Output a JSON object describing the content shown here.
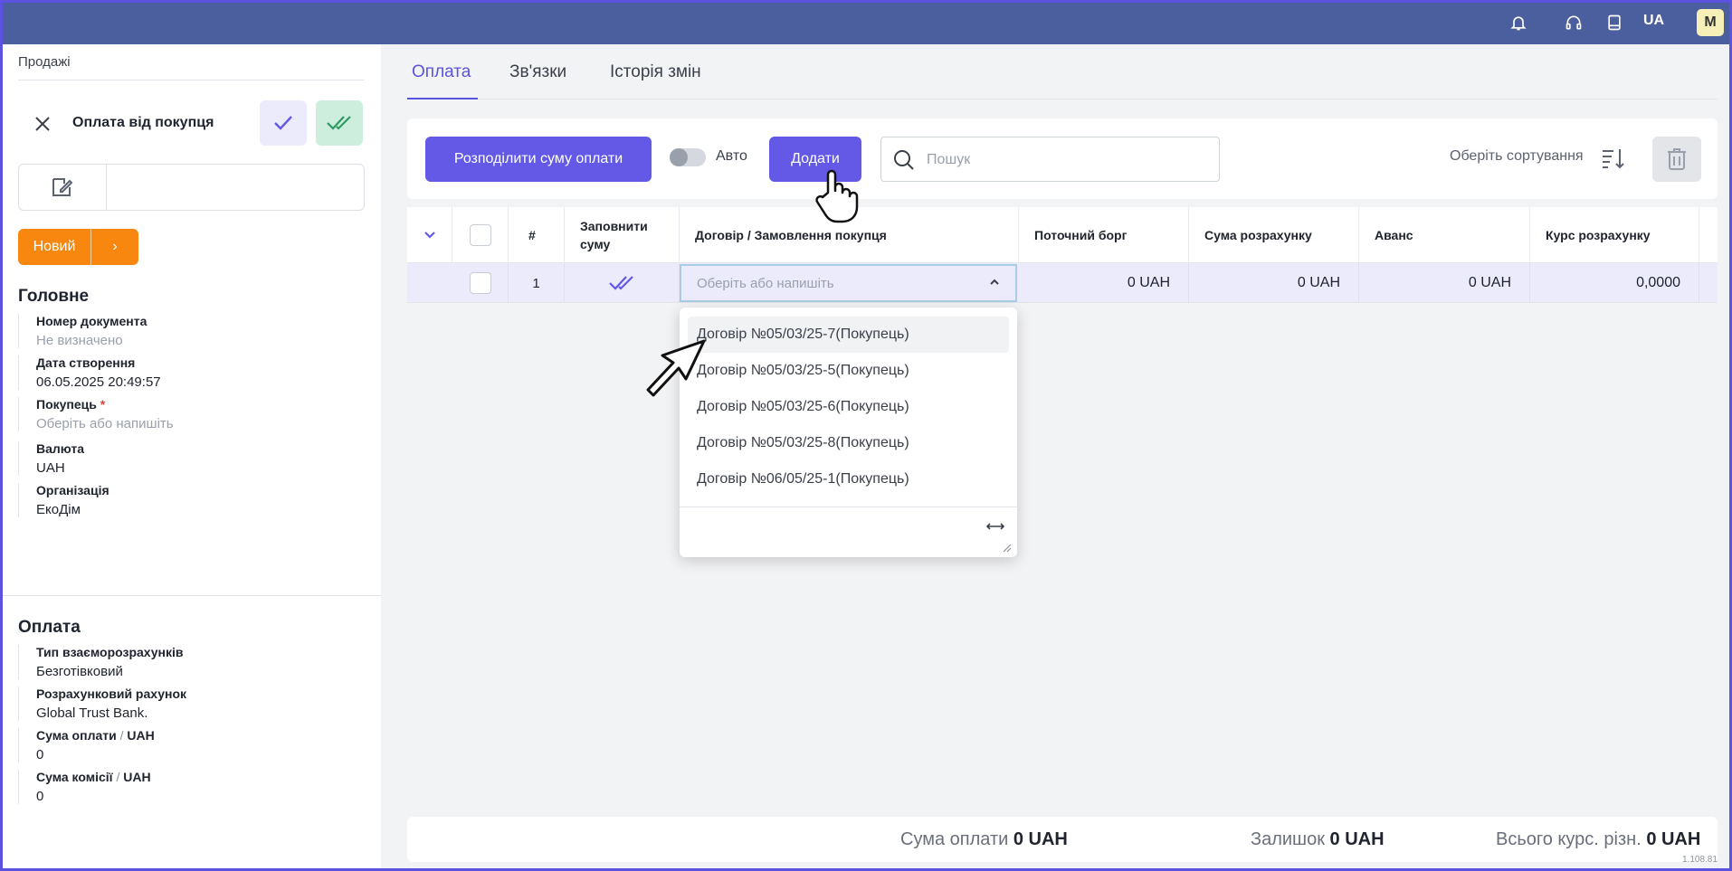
{
  "topbar": {
    "icons": [
      "bell-icon",
      "headset-icon",
      "book-icon"
    ],
    "lang": "UA",
    "avatar": "M"
  },
  "sidebar": {
    "breadcrumb": "Продажі",
    "doc_title": "Оплата від покупця",
    "status": "Новий",
    "status_color": "#f7870f",
    "main_section": {
      "title": "Головне",
      "fields": [
        {
          "label": "Номер документа",
          "value": "Не визначено"
        },
        {
          "label": "Дата створення",
          "value": "06.05.2025 20:49:57"
        },
        {
          "label": "Покупець",
          "required_mark": "*",
          "placeholder": "Оберіть або напишіть"
        },
        {
          "label": "Валюта",
          "value": "UAH"
        },
        {
          "label": "Організація",
          "value": "ЕкоДім"
        }
      ]
    },
    "payment_section": {
      "title": "Оплата",
      "fields": [
        {
          "label": "Тип взаєморозрахунків",
          "value": "Безготівковий"
        },
        {
          "label": "Розрахунковий рахунок",
          "value": "Global Trust Bank."
        },
        {
          "label": "Сума оплати",
          "sep": " / ",
          "unit": "UAH",
          "value": "0"
        },
        {
          "label": "Сума комісії",
          "sep": " / ",
          "unit": "UAH",
          "value": "0"
        }
      ]
    }
  },
  "tabs": [
    {
      "label": "Оплата",
      "active": true
    },
    {
      "label": "Зв'язки",
      "active": false
    },
    {
      "label": "Історія змін",
      "active": false
    }
  ],
  "toolbar": {
    "distribute_label": "Розподілити суму оплати",
    "auto_label": "Авто",
    "add_label": "Додати",
    "search_placeholder": "Пошук",
    "sort_label": "Оберіть сортування",
    "accent": "#6359e6"
  },
  "table": {
    "headers": [
      "#",
      "Заповнити суму",
      "Договір / Замовлення покупця",
      "Поточний борг",
      "Сума розрахунку",
      "Аванс",
      "Курс розрахунку"
    ],
    "rows": [
      {
        "num": "1",
        "contract_placeholder": "Оберіть або напишіть",
        "debt": "0  UAH",
        "settlement": "0  UAH",
        "advance": "0  UAH",
        "rate": "0,0000"
      }
    ]
  },
  "dropdown": {
    "options": [
      "Договір №05/03/25-7(Покупець)",
      "Договір №05/03/25-5(Покупець)",
      "Договір №05/03/25-6(Покупець)",
      "Договір №05/03/25-8(Покупець)",
      "Договір №06/05/25-1(Покупець)"
    ]
  },
  "footer": {
    "payment_label": "Сума оплати",
    "payment_value": "0 UAH",
    "balance_label": "Залишок",
    "balance_value": "0 UAH",
    "diff_label": "Всього курс. різн.",
    "diff_value": "0 UAH"
  },
  "version": "1.108.81"
}
